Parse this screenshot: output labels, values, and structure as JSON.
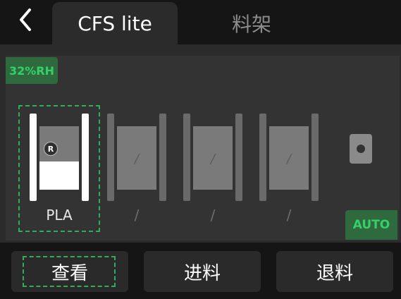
{
  "header": {
    "back_icon": "chevron-left-icon",
    "tabs": [
      {
        "label": "CFS lite",
        "active": true
      },
      {
        "label": "料架",
        "active": false
      }
    ]
  },
  "panel": {
    "humidity": "32%RH",
    "auto_label": "AUTO",
    "slots": [
      {
        "label": "PLA",
        "selected": true,
        "badge": "R",
        "fill_level": 0.45
      },
      {
        "label": "/",
        "core_mark": "/",
        "selected": false
      },
      {
        "label": "/",
        "core_mark": "/",
        "selected": false
      },
      {
        "label": "/",
        "core_mark": "/",
        "selected": false
      }
    ]
  },
  "actions": {
    "view": "查看",
    "load": "进料",
    "unload": "退料"
  },
  "colors": {
    "accent_green": "#2fae5a",
    "badge_bg": "#2f6a3f",
    "background": "#151515"
  }
}
